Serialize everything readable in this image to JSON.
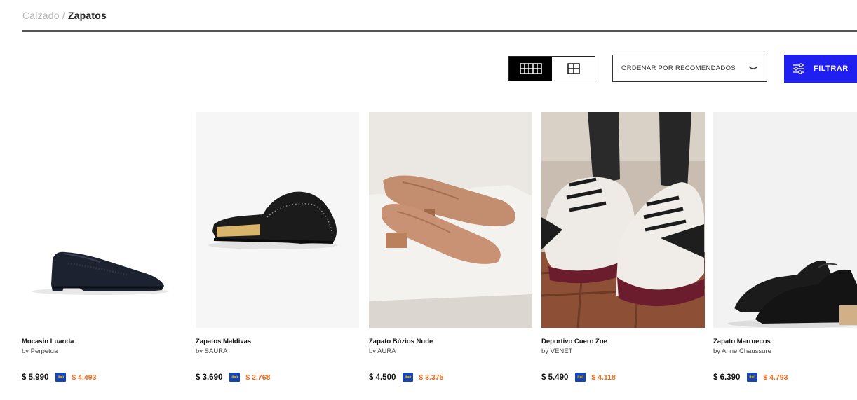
{
  "breadcrumb": {
    "parent": "Calzado",
    "separator": "/",
    "current": "Zapatos"
  },
  "toolbar": {
    "view_options": [
      {
        "icon": "grid-5-columns-icon",
        "active": true
      },
      {
        "icon": "grid-4-squares-icon",
        "active": false
      }
    ],
    "sort_label": "ORDENAR POR RECOMENDADOS",
    "sort_icon": "chevron-down-icon",
    "filter_label": "FILTRAR",
    "filter_icon": "sliders-icon",
    "filter_color": "#1f1ff0"
  },
  "bank_badge": {
    "text": "itaú",
    "color": "#1544b8"
  },
  "promo_color": "#f26a1b",
  "products": [
    {
      "name": "Mocasin Luanda",
      "brand": "by  Perpetua",
      "price": "$ 5.990",
      "promo_price": "$ 4.493"
    },
    {
      "name": "Zapatos Maldivas",
      "brand": "by  SAURA",
      "price": "$ 3.690",
      "promo_price": "$ 2.768"
    },
    {
      "name": "Zapato Búzios Nude",
      "brand": "by  AURA",
      "price": "$ 4.500",
      "promo_price": "$ 3.375"
    },
    {
      "name": "Deportivo Cuero Zoe",
      "brand": "by  VENET",
      "price": "$ 5.490",
      "promo_price": "$ 4.118"
    },
    {
      "name": "Zapato Marruecos",
      "brand": "by  Anne Chaussure",
      "price": "$ 6.390",
      "promo_price": "$ 4.793"
    }
  ]
}
